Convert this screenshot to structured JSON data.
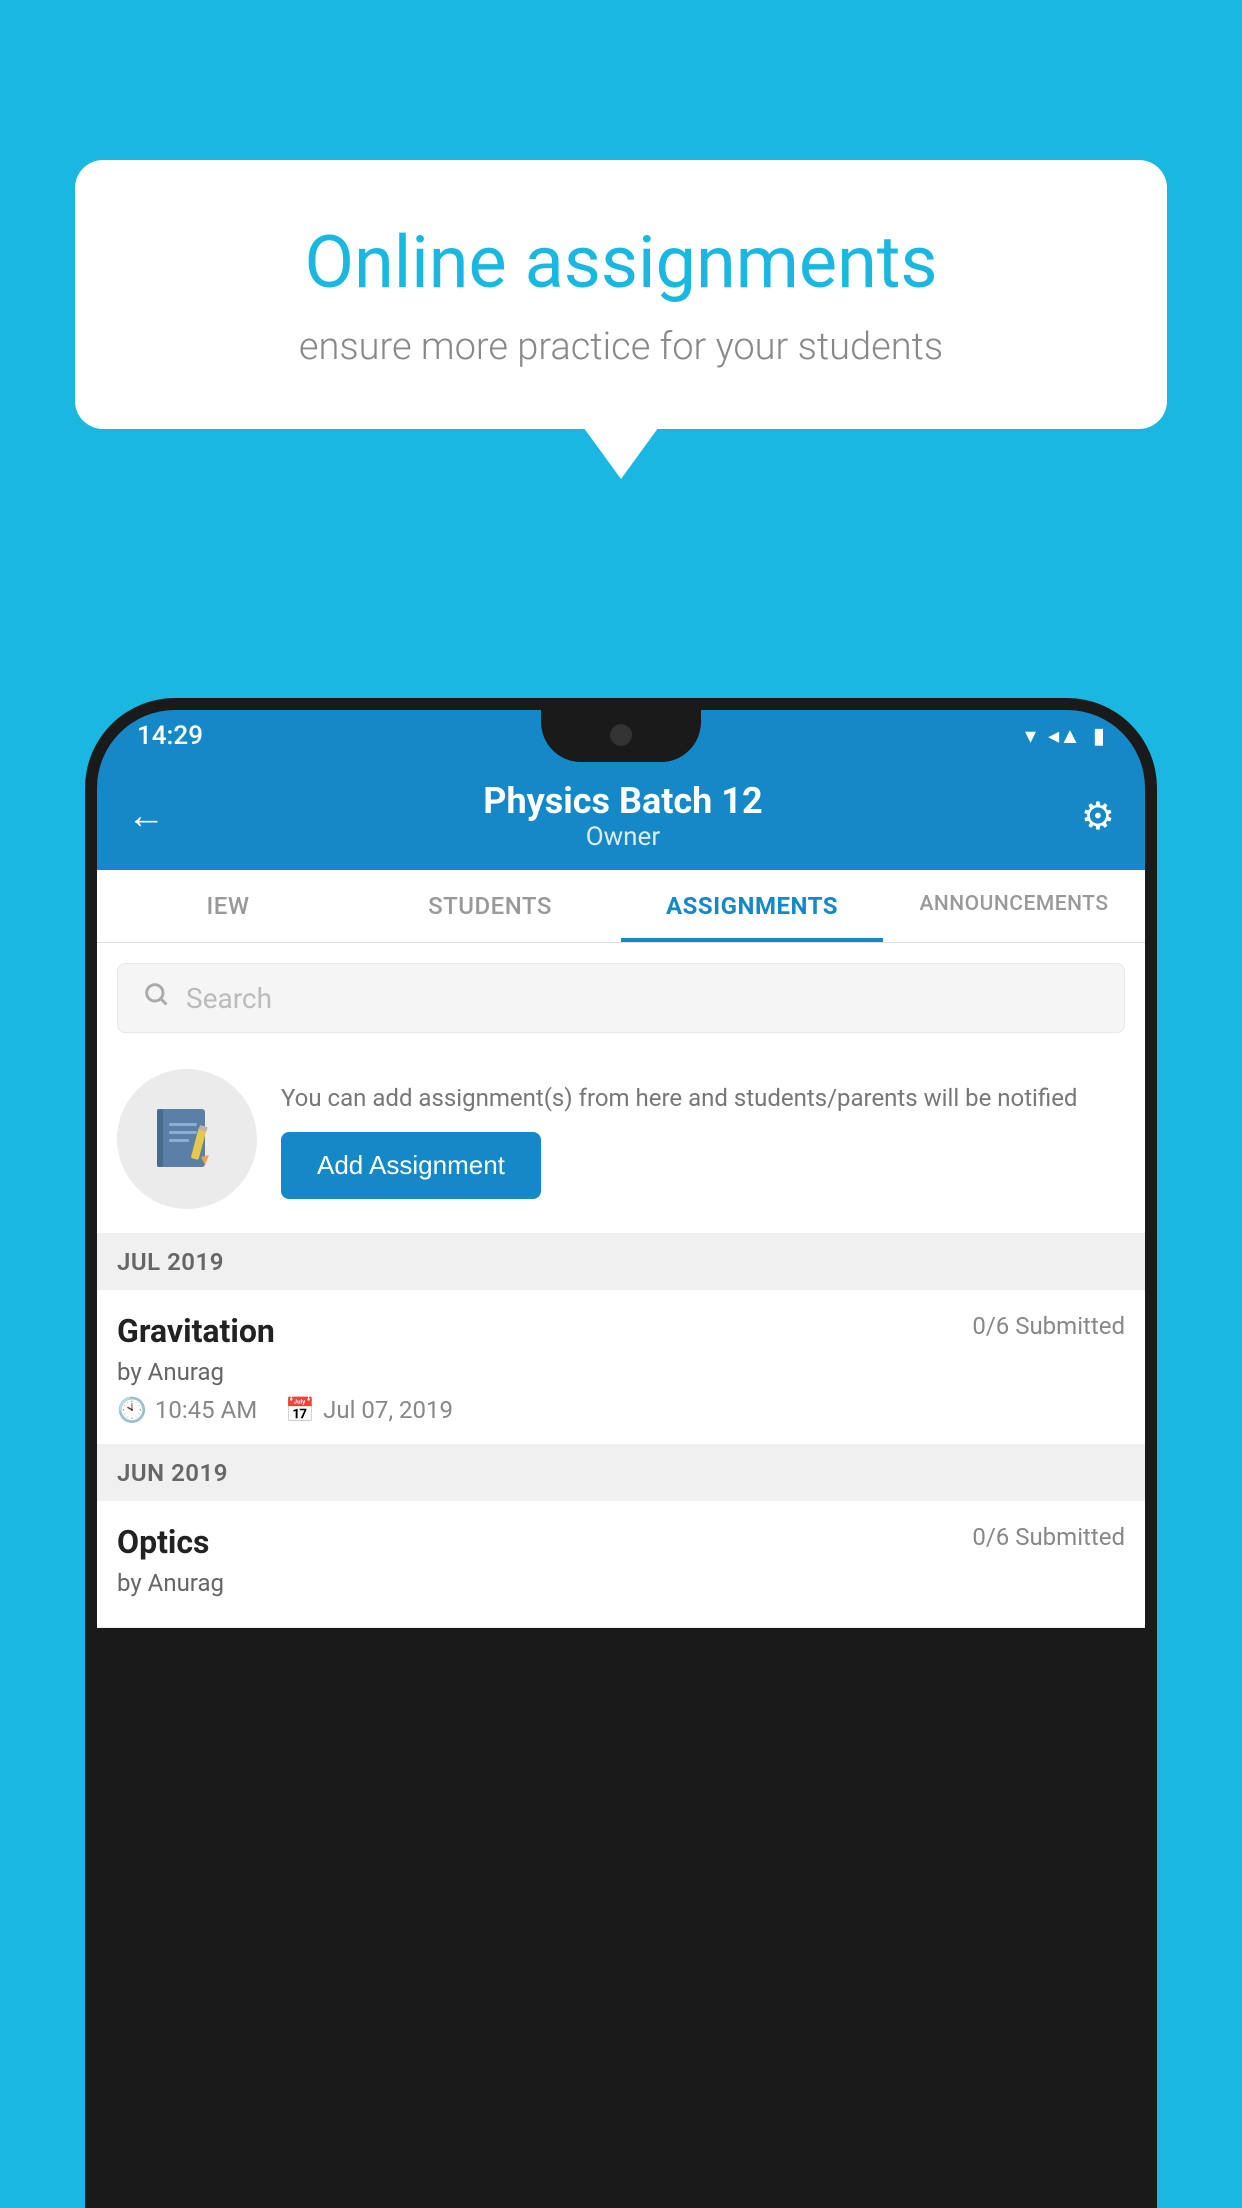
{
  "background_color": "#1ab8e0",
  "speech_bubble": {
    "title": "Online assignments",
    "subtitle": "ensure more practice for your students"
  },
  "status_bar": {
    "time": "14:29",
    "wifi_icon": "▾",
    "signal_icon": "◂",
    "battery_icon": "▮"
  },
  "header": {
    "title": "Physics Batch 12",
    "subtitle": "Owner",
    "back_label": "←",
    "settings_label": "⚙"
  },
  "tabs": [
    {
      "label": "IEW",
      "active": false
    },
    {
      "label": "STUDENTS",
      "active": false
    },
    {
      "label": "ASSIGNMENTS",
      "active": true
    },
    {
      "label": "ANNOUNCEMENTS",
      "active": false
    }
  ],
  "search": {
    "placeholder": "Search"
  },
  "promo": {
    "description": "You can add assignment(s) from here and students/parents will be notified",
    "button_label": "Add Assignment"
  },
  "sections": [
    {
      "label": "JUL 2019",
      "assignments": [
        {
          "name": "Gravitation",
          "submitted": "0/6 Submitted",
          "by": "by Anurag",
          "time": "10:45 AM",
          "date": "Jul 07, 2019"
        }
      ]
    },
    {
      "label": "JUN 2019",
      "assignments": [
        {
          "name": "Optics",
          "submitted": "0/6 Submitted",
          "by": "by Anurag",
          "time": "",
          "date": ""
        }
      ]
    }
  ]
}
